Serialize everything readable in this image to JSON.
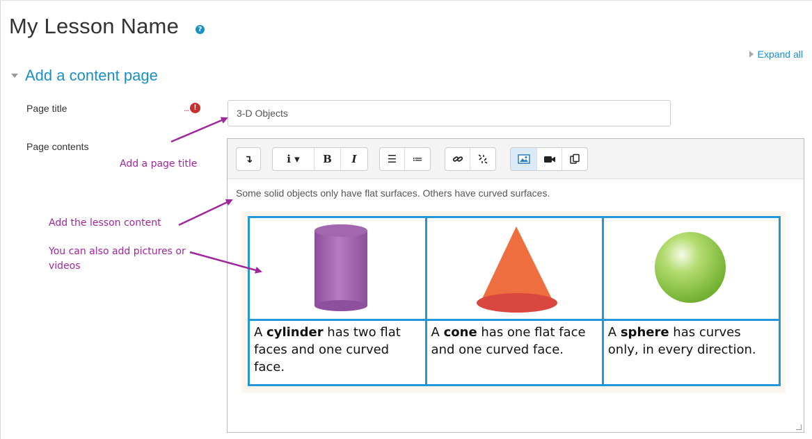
{
  "lesson": {
    "title": "My Lesson Name",
    "help_icon": "question-circle"
  },
  "expand_all": "Expand all",
  "section": {
    "title": "Add a content page"
  },
  "fields": {
    "page_title_label": "Page title",
    "page_title_value": "3-D Objects",
    "page_title_required": "!",
    "page_contents_label": "Page contents"
  },
  "toolbar": {
    "buttons": [
      {
        "name": "collapse-toggle",
        "glyph": "↴"
      },
      {
        "name": "paragraph-styles",
        "glyph": "i ▾"
      },
      {
        "name": "bold",
        "glyph": "B"
      },
      {
        "name": "italic",
        "glyph": "I"
      },
      {
        "name": "unordered-list",
        "glyph": "☰"
      },
      {
        "name": "ordered-list",
        "glyph": "≔"
      },
      {
        "name": "link",
        "glyph": "🔗"
      },
      {
        "name": "unlink",
        "glyph": "⛓"
      },
      {
        "name": "insert-image",
        "glyph": "▣"
      },
      {
        "name": "insert-media",
        "glyph": "■"
      },
      {
        "name": "manage-files",
        "glyph": "⧉"
      }
    ]
  },
  "editor": {
    "intro": "Some solid objects only have flat surfaces. Others have curved surfaces.",
    "shapes": [
      {
        "name": "cylinder",
        "caption_pre": "A ",
        "caption_bold": "cylinder",
        "caption_post": " has two flat faces and one curved face.",
        "color": "#a665b3"
      },
      {
        "name": "cone",
        "caption_pre": "A ",
        "caption_bold": "cone",
        "caption_post": " has one flat face and one curved face.",
        "color": "#ef6e3f"
      },
      {
        "name": "sphere",
        "caption_pre": "A ",
        "caption_bold": "sphere",
        "caption_post": " has curves only, in every direction.",
        "color": "#8cc63f"
      }
    ]
  },
  "annotations": {
    "title_note": "Add a page title",
    "content_note": "Add the lesson content",
    "pictures_note": "You can also add pictures or videos",
    "color": "#a0279b"
  },
  "colors": {
    "accent": "#1a8fc7",
    "table_border": "#2596d9",
    "required": "#c9302c"
  }
}
